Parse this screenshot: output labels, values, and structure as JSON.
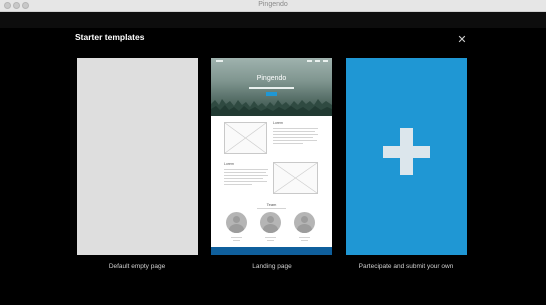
{
  "window": {
    "title": "Pingendo"
  },
  "modal": {
    "title": "Starter templates",
    "close_icon": "close-icon"
  },
  "templates": [
    {
      "label": "Default empty page"
    },
    {
      "label": "Landing page",
      "preview": {
        "hero_title": "Pingendo",
        "section_heading_1": "Lorem",
        "section_heading_2": "Lorem",
        "team_heading": "Team"
      }
    },
    {
      "label": "Partecipate and submit your own",
      "icon": "plus-icon"
    }
  ],
  "colors": {
    "accent": "#1f97d4",
    "empty_card": "#dedede",
    "footer": "#0f5f9c"
  }
}
